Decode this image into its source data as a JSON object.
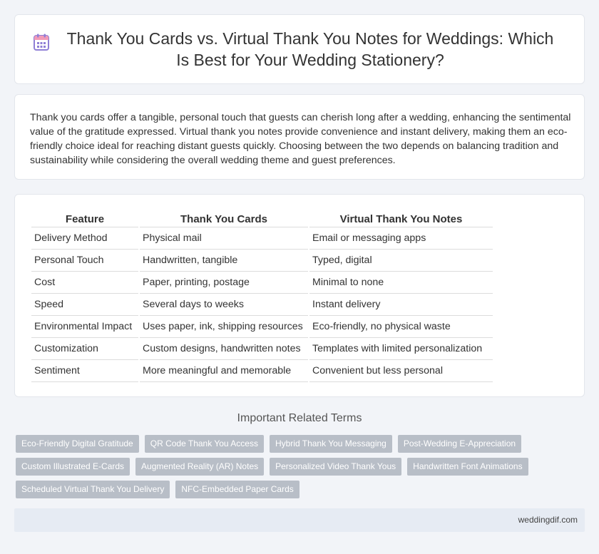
{
  "header": {
    "title": "Thank You Cards vs. Virtual Thank You Notes for Weddings: Which Is Best for Your Wedding Stationery?",
    "icon": "calendar-icon"
  },
  "summary": {
    "text": "Thank you cards offer a tangible, personal touch that guests can cherish long after a wedding, enhancing the sentimental value of the gratitude expressed. Virtual thank you notes provide convenience and instant delivery, making them an eco-friendly choice ideal for reaching distant guests quickly. Choosing between the two depends on balancing tradition and sustainability while considering the overall wedding theme and guest preferences."
  },
  "table": {
    "headers": [
      "Feature",
      "Thank You Cards",
      "Virtual Thank You Notes"
    ],
    "rows": [
      [
        "Delivery Method",
        "Physical mail",
        "Email or messaging apps"
      ],
      [
        "Personal Touch",
        "Handwritten, tangible",
        "Typed, digital"
      ],
      [
        "Cost",
        "Paper, printing, postage",
        "Minimal to none"
      ],
      [
        "Speed",
        "Several days to weeks",
        "Instant delivery"
      ],
      [
        "Environmental Impact",
        "Uses paper, ink, shipping resources",
        "Eco-friendly, no physical waste"
      ],
      [
        "Customization",
        "Custom designs, handwritten notes",
        "Templates with limited personalization"
      ],
      [
        "Sentiment",
        "More meaningful and memorable",
        "Convenient but less personal"
      ]
    ]
  },
  "related": {
    "title": "Important Related Terms",
    "tags": [
      "Eco-Friendly Digital Gratitude",
      "QR Code Thank You Access",
      "Hybrid Thank You Messaging",
      "Post-Wedding E-Appreciation",
      "Custom Illustrated E-Cards",
      "Augmented Reality (AR) Notes",
      "Personalized Video Thank Yous",
      "Handwritten Font Animations",
      "Scheduled Virtual Thank You Delivery",
      "NFC-Embedded Paper Cards"
    ]
  },
  "footer": {
    "site": "weddingdif.com"
  },
  "colors": {
    "icon_purple": "#8f7fd6",
    "icon_pink": "#f29ab8",
    "tag_bg": "#b8bec7",
    "footer_bg": "#e6ebf3"
  }
}
